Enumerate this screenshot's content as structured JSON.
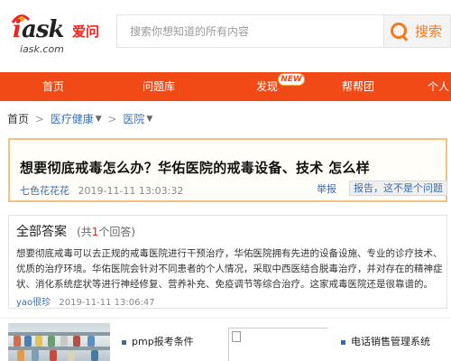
{
  "logo": {
    "brand": "ask",
    "cn_name": "爱问",
    "domain": "iask.com"
  },
  "search": {
    "placeholder": "搜索你想知道的所有内容",
    "button_label": "搜索",
    "accent_color": "#f37a1f"
  },
  "nav": {
    "color": "#f24a17",
    "items": [
      {
        "label": "首页"
      },
      {
        "label": "问题库"
      },
      {
        "label": "发现"
      },
      {
        "label": "帮帮团"
      },
      {
        "label": "个人"
      }
    ],
    "new_badge": "NEW"
  },
  "breadcrumb": {
    "home": "首页",
    "sep": ">",
    "level1": "医疗健康",
    "level2": "医院"
  },
  "question": {
    "title": "想要彻底戒毒怎么办？华佑医院的戒毒设备、技术 怎么样",
    "author": "七色花花花",
    "time": "2019-11-11 13:03:32",
    "report": "举报",
    "feedback": "报告，这不是个问题"
  },
  "answers": {
    "heading": "全部答案",
    "count_prefix": "(共",
    "count": "1",
    "count_suffix": "个回答)",
    "items": [
      {
        "text": "想要彻底戒毒可以去正规的戒毒医院进行干预治疗，华佑医院拥有先进的设备设施、专业的诊疗技术、优质的治疗环境。华佑医院会针对不同患者的个人情况，采取中西医结合脱毒治疗，并对存在的精神症状、消化系统症状等进行神经修复、营养补充、免疫调节等综合治疗。这家戒毒医院还是很靠谱的。",
        "author": "yao很珍",
        "time": "2019-11-11 13:06:47"
      }
    ]
  },
  "ads": {
    "item1": "pmp报考条件",
    "item2": "电话销售管理系统"
  }
}
